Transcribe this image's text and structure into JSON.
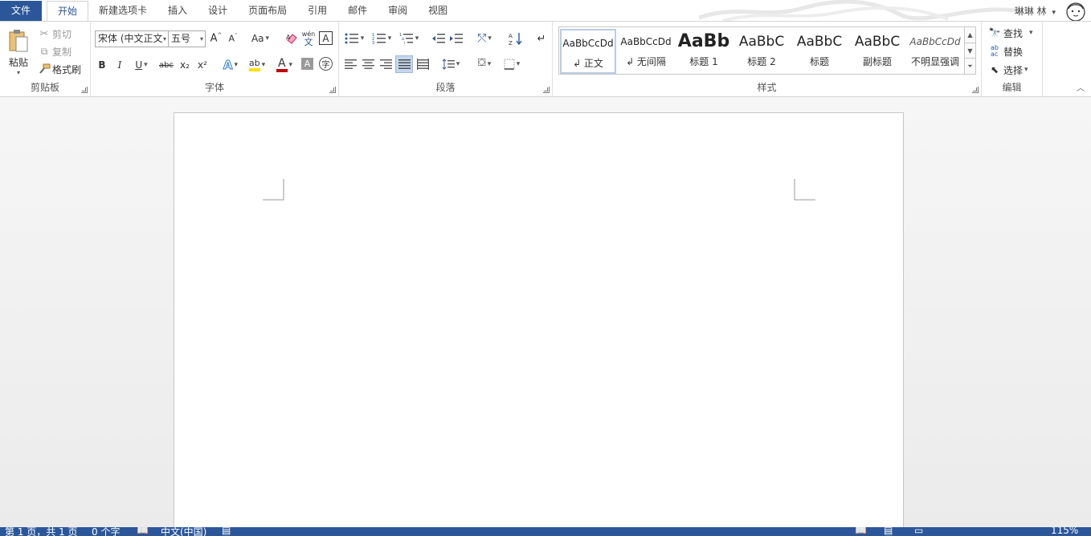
{
  "tabs": [
    "文件",
    "开始",
    "新建选项卡",
    "插入",
    "设计",
    "页面布局",
    "引用",
    "邮件",
    "审阅",
    "视图"
  ],
  "active_tab": "开始",
  "user": {
    "name": "琳琳 林",
    "dropdown": "▾"
  },
  "clipboard": {
    "paste": "粘贴",
    "cut": "剪切",
    "copy": "复制",
    "format_painter": "格式刷",
    "label": "剪贴板"
  },
  "font": {
    "font_name": "宋体 (中文正文",
    "font_size": "五号",
    "change_case": "Aa",
    "phonetic_top": "wén",
    "phonetic_bottom": "文",
    "bold": "B",
    "italic": "I",
    "underline": "U",
    "strikethrough": "abc",
    "subscript": "x₂",
    "superscript": "x²",
    "label": "字体",
    "highlight_color": "#ffe000",
    "font_color": "#c00000"
  },
  "paragraph": {
    "label": "段落"
  },
  "styles": {
    "label": "样式",
    "items": [
      {
        "preview": "AaBbCcDd",
        "name": "↲ 正文"
      },
      {
        "preview": "AaBbCcDd",
        "name": "↲ 无间隔"
      },
      {
        "preview": "AaBb",
        "name": "标题 1"
      },
      {
        "preview": "AaBbC",
        "name": "标题 2"
      },
      {
        "preview": "AaBbC",
        "name": "标题"
      },
      {
        "preview": "AaBbC",
        "name": "副标题"
      },
      {
        "preview": "AaBbCcDd",
        "name": "不明显强调"
      }
    ]
  },
  "editing": {
    "find": "查找",
    "replace": "替换",
    "select": "选择",
    "label": "编辑"
  },
  "status": {
    "page": "第 1 页，共 1 页",
    "words": "0 个字",
    "language": "中文(中国)",
    "zoom": "115%"
  },
  "colors": {
    "accent": "#2b579a"
  }
}
